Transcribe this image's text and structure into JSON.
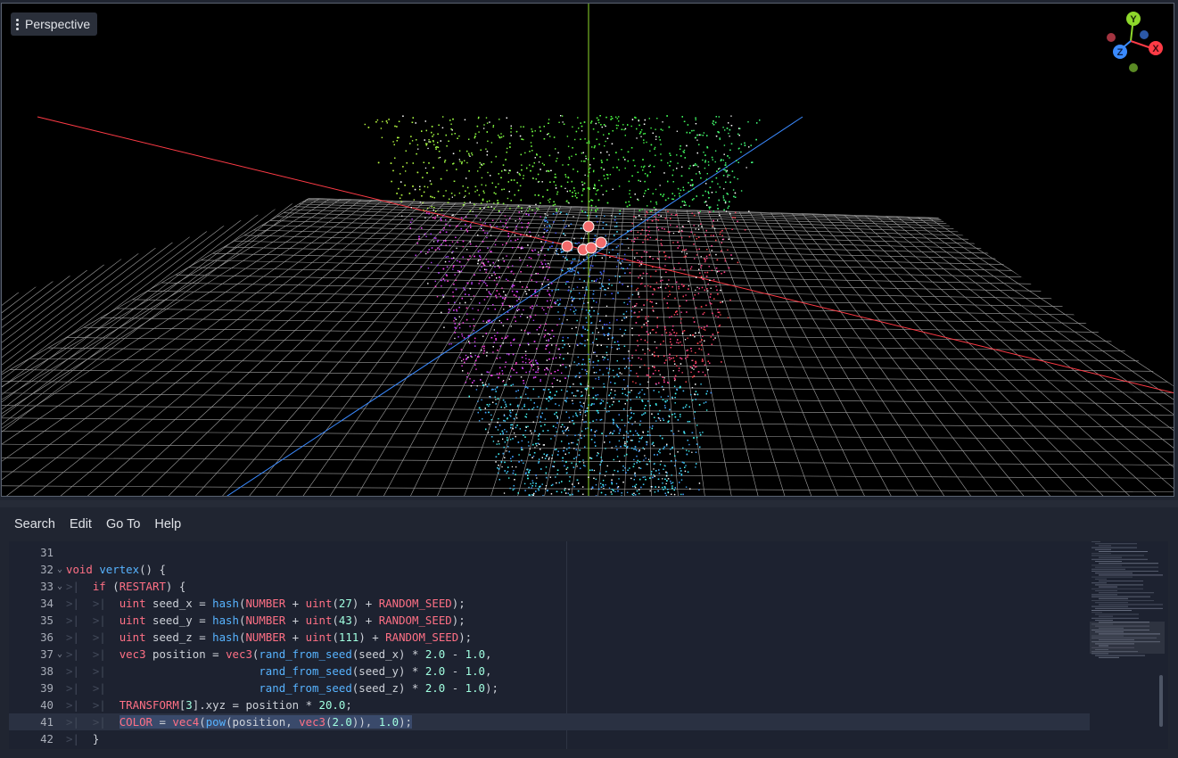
{
  "viewport": {
    "mode_label": "Perspective",
    "gizmo": {
      "x_label": "X",
      "y_label": "Y",
      "z_label": "Z"
    },
    "colors": {
      "x_axis": "#ff3b46",
      "y_axis": "#8ed82b",
      "z_axis": "#3a8aff",
      "grid": "#d8d8d8"
    }
  },
  "menu": {
    "items": [
      {
        "label": "Search"
      },
      {
        "label": "Edit"
      },
      {
        "label": "Go To"
      },
      {
        "label": "Help"
      }
    ]
  },
  "editor": {
    "current_line": "41",
    "lines": [
      {
        "num": "31"
      },
      {
        "num": "32"
      },
      {
        "num": "33"
      },
      {
        "num": "34"
      },
      {
        "num": "35"
      },
      {
        "num": "36"
      },
      {
        "num": "37"
      },
      {
        "num": "38"
      },
      {
        "num": "39"
      },
      {
        "num": "40"
      },
      {
        "num": "41"
      },
      {
        "num": "42"
      }
    ],
    "tokens": {
      "void": "void",
      "vertex": "vertex",
      "vertex_rest": "() {",
      "if": "if",
      "paren_open": " (",
      "restart": "RESTART",
      "paren_close": ") {",
      "uint": "uint",
      "seed_x_decl": " seed_x = ",
      "seed_y_decl": " seed_y = ",
      "seed_z_decl": " seed_z = ",
      "hash": "hash",
      "number": "NUMBER",
      "uint_call": "uint",
      "n27": "27",
      "n43": "43",
      "n111": "111",
      "random_seed": "RANDOM_SEED",
      "vec3": "vec3",
      "position_decl": " position = ",
      "rand_from_seed": "rand_from_seed",
      "seed_x": "(seed_x) * ",
      "seed_y": "(seed_y) * ",
      "seed_z": "(seed_z) * ",
      "n2": "2.0",
      "minus": " - ",
      "n1": "1.0",
      "transform": "TRANSFORM",
      "idx3": "3",
      "transform_rest": "].xyz = position * ",
      "n20": "20.0",
      "color": "COLOR",
      "assign": " = ",
      "vec4": "vec4",
      "pow": "pow",
      "pos_arg": "(position, ",
      "close_brace": "}"
    }
  }
}
